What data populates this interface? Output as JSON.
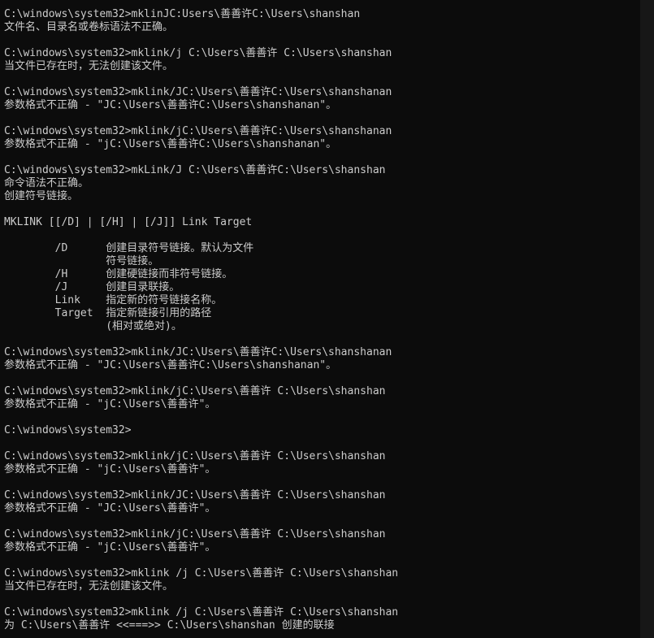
{
  "console": {
    "lines": [
      "C:\\windows\\system32>mklinJC:Users\\善善许C:\\Users\\shanshan",
      "文件名、目录名或卷标语法不正确。",
      "",
      "C:\\windows\\system32>mklink/j C:\\Users\\善善许 C:\\Users\\shanshan",
      "当文件已存在时，无法创建该文件。",
      "",
      "C:\\windows\\system32>mklink/JC:\\Users\\善善许C:\\Users\\shanshanan",
      "参数格式不正确 - \"JC:\\Users\\善善许C:\\Users\\shanshanan\"。",
      "",
      "C:\\windows\\system32>mklink/jC:\\Users\\善善许C:\\Users\\shanshanan",
      "参数格式不正确 - \"jC:\\Users\\善善许C:\\Users\\shanshanan\"。",
      "",
      "C:\\windows\\system32>mkLink/J C:\\Users\\善善许C:\\Users\\shanshan",
      "命令语法不正确。",
      "创建符号链接。",
      "",
      "MKLINK [[/D] | [/H] | [/J]] Link Target",
      "",
      "        /D      创建目录符号链接。默认为文件",
      "                符号链接。",
      "        /H      创建硬链接而非符号链接。",
      "        /J      创建目录联接。",
      "        Link    指定新的符号链接名称。",
      "        Target  指定新链接引用的路径",
      "                (相对或绝对)。",
      "",
      "C:\\windows\\system32>mklink/JC:\\Users\\善善许C:\\Users\\shanshanan",
      "参数格式不正确 - \"JC:\\Users\\善善许C:\\Users\\shanshanan\"。",
      "",
      "C:\\windows\\system32>mklink/jC:\\Users\\善善许 C:\\Users\\shanshan",
      "参数格式不正确 - \"jC:\\Users\\善善许\"。",
      "",
      "C:\\windows\\system32>",
      "",
      "C:\\windows\\system32>mklink/jC:\\Users\\善善许 C:\\Users\\shanshan",
      "参数格式不正确 - \"jC:\\Users\\善善许\"。",
      "",
      "C:\\windows\\system32>mklink/JC:\\Users\\善善许 C:\\Users\\shanshan",
      "参数格式不正确 - \"JC:\\Users\\善善许\"。",
      "",
      "C:\\windows\\system32>mklink/jC:\\Users\\善善许 C:\\Users\\shanshan",
      "参数格式不正确 - \"jC:\\Users\\善善许\"。",
      "",
      "C:\\windows\\system32>mklink /j C:\\Users\\善善许 C:\\Users\\shanshan",
      "当文件已存在时，无法创建该文件。",
      "",
      "C:\\windows\\system32>mklink /j C:\\Users\\善善许 C:\\Users\\shanshan",
      "为 C:\\Users\\善善许 <<===>> C:\\Users\\shanshan 创建的联接"
    ]
  },
  "colors": {
    "background": "#0c0c0c",
    "text": "#cccccc"
  }
}
